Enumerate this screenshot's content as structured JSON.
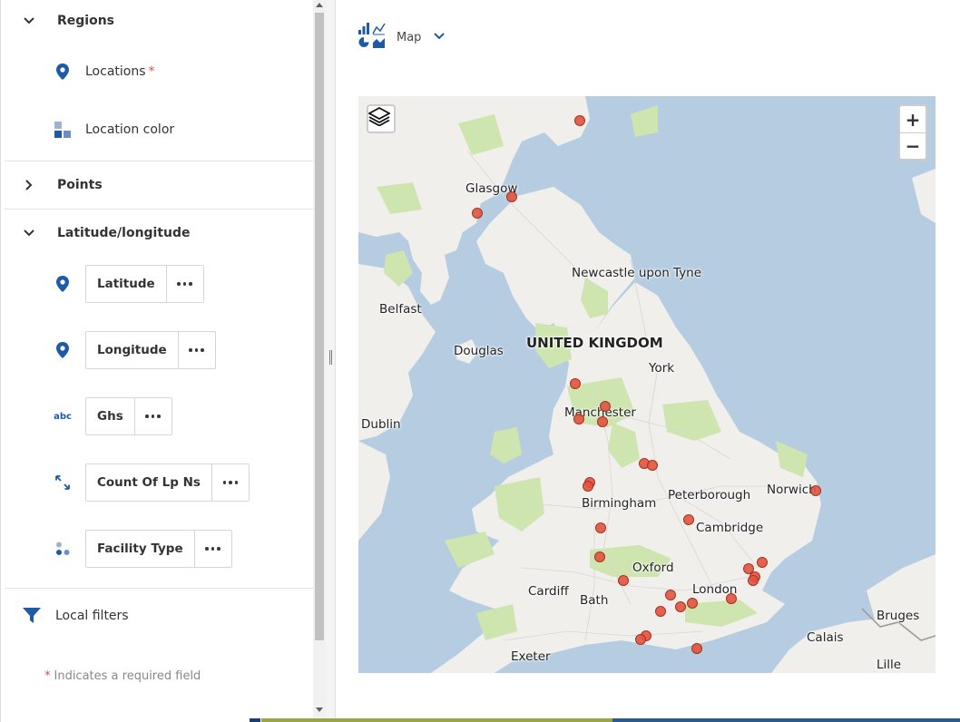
{
  "sections": {
    "regions": {
      "title": "Regions",
      "items": [
        {
          "label": "Locations",
          "required_mark": "*",
          "icon": "location-pin-icon"
        },
        {
          "label": "Location color",
          "icon": "color-squares-icon"
        }
      ]
    },
    "points": {
      "title": "Points"
    },
    "latlong": {
      "title": "Latitude/longitude",
      "items": [
        {
          "label": "Latitude",
          "icon": "location-pin-icon"
        },
        {
          "label": "Longitude",
          "icon": "location-pin-icon"
        },
        {
          "label": "Ghs",
          "icon": "abc-text-icon",
          "icon_text": "abc"
        },
        {
          "label": "Count Of Lp Ns",
          "icon": "resize-arrows-icon"
        },
        {
          "label": "Facility Type",
          "icon": "dots-cluster-icon"
        }
      ]
    },
    "local_filters": {
      "label": "Local filters",
      "icon": "filter-icon"
    }
  },
  "required_note": {
    "star": "*",
    "text": "Indicates a required field"
  },
  "viz_selector": {
    "label": "Map",
    "icon": "chart-types-icon"
  },
  "map": {
    "zoom_in": "+",
    "zoom_out": "−",
    "labels": {
      "glasgow": "Glasgow",
      "newcastle": "Newcastle upon Tyne",
      "belfast": "Belfast",
      "douglas": "Douglas",
      "uk": "UNITED KINGDOM",
      "york": "York",
      "dublin": "Dublin",
      "manchester": "Manchester",
      "birmingham": "Birmingham",
      "peterborough": "Peterborough",
      "norwich": "Norwich",
      "cambridge": "Cambridge",
      "oxford": "Oxford",
      "cardiff": "Cardiff",
      "london": "London",
      "bath": "Bath",
      "bruges": "Bruges",
      "calais": "Calais",
      "exeter": "Exeter",
      "lille": "Lille"
    }
  },
  "colors": {
    "accent": "#1f5aa6",
    "marker_fill": "#e0533f",
    "sea": "#b6cde1",
    "land": "#f0efec",
    "park": "#cfe5b0",
    "required": "#d9534f"
  }
}
